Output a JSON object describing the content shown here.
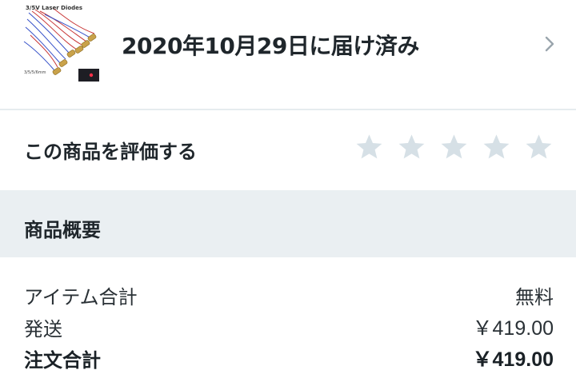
{
  "order": {
    "thumbnail_caption": "3/5V Laser Diodes",
    "thumbnail_size": "3/5/5/6mm",
    "status": "2020年10月29日に届け済み",
    "chevron_icon": "chevron-right-icon"
  },
  "rating": {
    "label": "この商品を評価する",
    "stars": 5,
    "star_color": "#d6e0e6"
  },
  "summary": {
    "title": "商品概要",
    "lines": [
      {
        "label": "アイテム合計",
        "value": "無料"
      },
      {
        "label": "発送",
        "value": "￥419.00"
      },
      {
        "label": "注文合計",
        "value": "￥419.00"
      }
    ]
  },
  "colors": {
    "header_bg": "#eaeff2",
    "divider": "#e6ecef",
    "text": "#1f262b"
  }
}
